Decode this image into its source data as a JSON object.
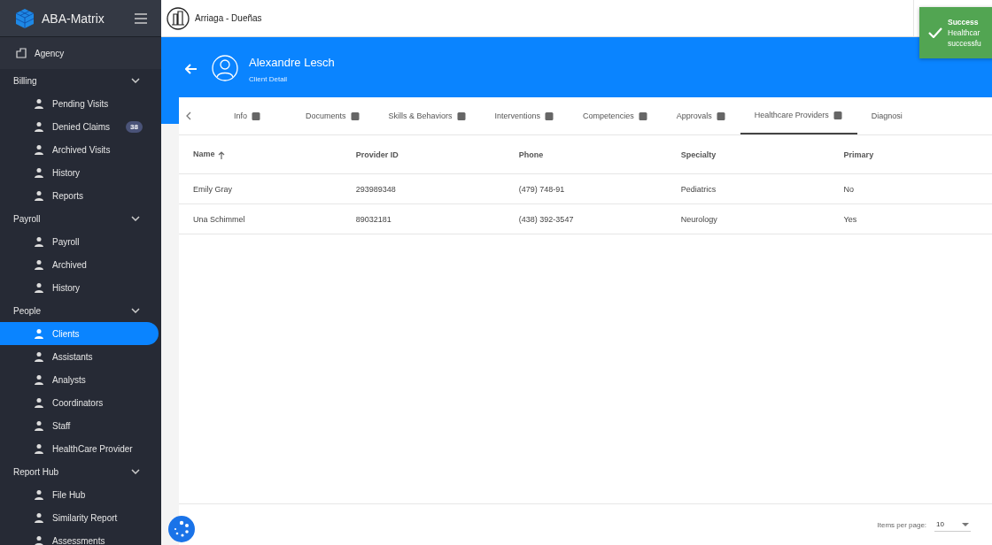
{
  "sidebar": {
    "brand": "ABA-Matrix",
    "top_item": {
      "label": "Agency"
    },
    "sections": [
      {
        "label": "Billing",
        "expanded": true,
        "items": [
          {
            "label": "Pending Visits",
            "selected": false
          },
          {
            "label": "Denied Claims",
            "selected": false,
            "badge": "38"
          },
          {
            "label": "Archived Visits",
            "selected": false
          },
          {
            "label": "History",
            "selected": false
          },
          {
            "label": "Reports",
            "selected": false
          }
        ]
      },
      {
        "label": "Payroll",
        "expanded": true,
        "items": [
          {
            "label": "Payroll",
            "selected": false
          },
          {
            "label": "Archived",
            "selected": false
          },
          {
            "label": "History",
            "selected": false
          }
        ]
      },
      {
        "label": "People",
        "expanded": true,
        "items": [
          {
            "label": "Clients",
            "selected": true
          },
          {
            "label": "Assistants",
            "selected": false
          },
          {
            "label": "Analysts",
            "selected": false
          },
          {
            "label": "Coordinators",
            "selected": false
          },
          {
            "label": "Staff",
            "selected": false
          },
          {
            "label": "HealthCare Provider",
            "selected": false
          }
        ]
      },
      {
        "label": "Report Hub",
        "expanded": true,
        "items": [
          {
            "label": "File Hub",
            "selected": false
          },
          {
            "label": "Similarity Report",
            "selected": false
          },
          {
            "label": "Assessments",
            "selected": false
          }
        ]
      }
    ]
  },
  "topbar": {
    "agency": "Arriaga - Dueñas"
  },
  "toast": {
    "title": "Success",
    "lines": [
      "Healthcar",
      "successfu"
    ]
  },
  "client": {
    "name": "Alexandre Lesch",
    "subtitle": "Client Detail"
  },
  "tabs": [
    {
      "label": "Info",
      "selected": false
    },
    {
      "label": "Documents",
      "selected": false
    },
    {
      "label": "Skills & Behaviors",
      "selected": false
    },
    {
      "label": "Interventions",
      "selected": false
    },
    {
      "label": "Competencies",
      "selected": false
    },
    {
      "label": "Approvals",
      "selected": false
    },
    {
      "label": "Healthcare Providers",
      "selected": true
    },
    {
      "label": "Diagnosi",
      "selected": false
    }
  ],
  "table": {
    "columns": [
      "Name",
      "Provider ID",
      "Phone",
      "Specialty",
      "Primary"
    ],
    "rows": [
      [
        "Emily Gray",
        "293989348",
        "(479) 748-91",
        "Pediatrics",
        "No"
      ],
      [
        "Una Schimmel",
        "89032181",
        "(438) 392-3547",
        "Neurology",
        "Yes"
      ]
    ]
  },
  "paginator": {
    "label": "Items per page:",
    "value": "10"
  }
}
